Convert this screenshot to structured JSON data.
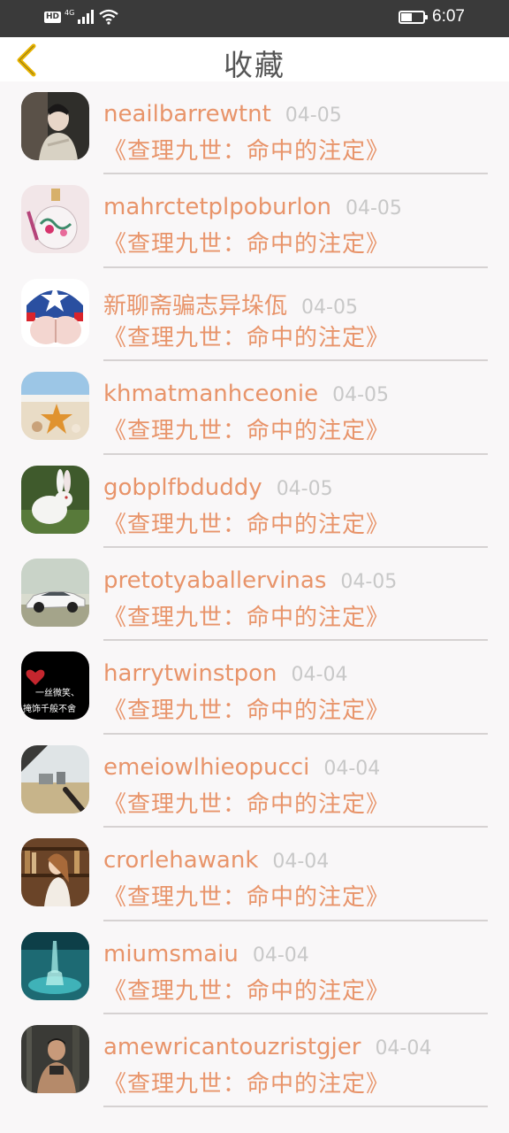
{
  "status_bar": {
    "hd_label": "HD",
    "network_label": "4G",
    "time": "6:07",
    "battery_level": 0.45,
    "icons": [
      "hd-icon",
      "signal-icon",
      "wifi-icon",
      "battery-icon"
    ]
  },
  "header": {
    "title": "收藏",
    "back_icon": "chevron-left-icon",
    "back_color": "#e8b400"
  },
  "colors": {
    "accent": "#e8946a",
    "date": "#c8c8c8",
    "separator": "#d6d2d2",
    "background": "#f9f7f8"
  },
  "favorites": [
    {
      "user": "neailbarrewtnt",
      "date": "04-05",
      "book": "《查理九世：命中的注定》",
      "avatar": "person-in-sweater"
    },
    {
      "user": "mahrctetplpoburlon",
      "date": "04-05",
      "book": "《查理九世：命中的注定》",
      "avatar": "perfume-bottle"
    },
    {
      "user": "新聊斋骗志异垛佤",
      "date": "04-05",
      "book": "《查理九世：命中的注定》",
      "avatar": "captain-america-shorts"
    },
    {
      "user": "khmatmanhceonie",
      "date": "04-05",
      "book": "《查理九世：命中的注定》",
      "avatar": "starfish-beach"
    },
    {
      "user": "gobplfbduddy",
      "date": "04-05",
      "book": "《查理九世：命中的注定》",
      "avatar": "white-rabbit"
    },
    {
      "user": "pretotyaballervinas",
      "date": "04-05",
      "book": "《查理九世：命中的注定》",
      "avatar": "white-car"
    },
    {
      "user": "harrytwinstpon",
      "date": "04-04",
      "book": "《查理九世：命中的注定》",
      "avatar": "heart-text",
      "avatar_text": [
        "一丝微笑、",
        "掩饰千般不舍"
      ]
    },
    {
      "user": "emeiowlhieopucci",
      "date": "04-04",
      "book": "《查理九世：命中的注定》",
      "avatar": "field-house"
    },
    {
      "user": "crorlehawank",
      "date": "04-04",
      "book": "《查理九世：命中的注定》",
      "avatar": "girl-bookshelf"
    },
    {
      "user": "miumsmaiu",
      "date": "04-04",
      "book": "《查理九世：命中的注定》",
      "avatar": "underwater-figure"
    },
    {
      "user": "amewricantouzristgjer",
      "date": "04-04",
      "book": "《查理九世：命中的注定》",
      "avatar": "man-forest"
    }
  ]
}
